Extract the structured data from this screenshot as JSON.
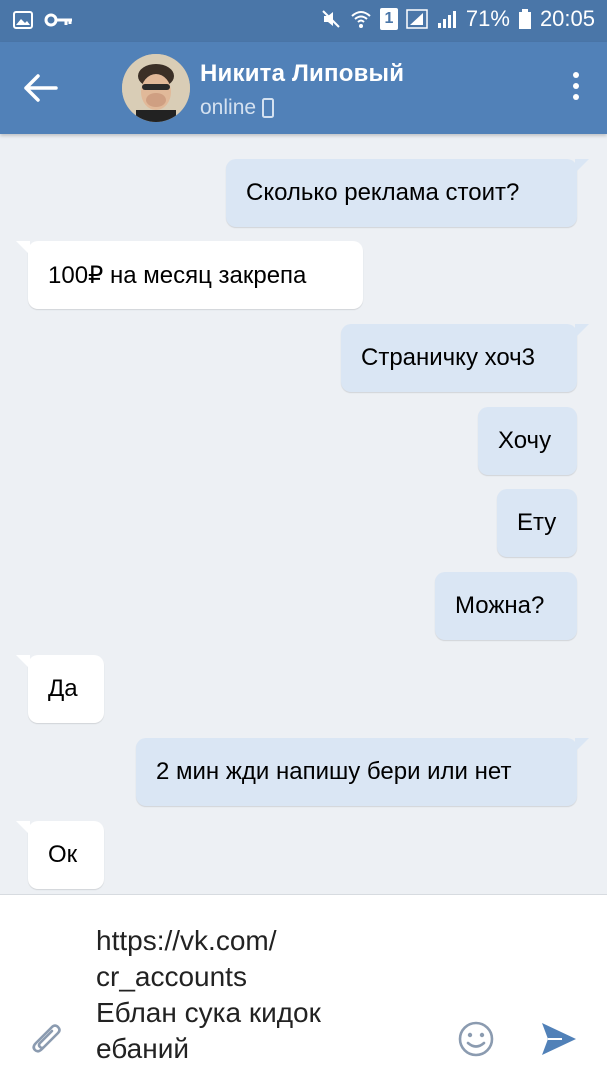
{
  "status_bar": {
    "battery": "71%",
    "time": "20:05",
    "sim_label": "1",
    "icons": [
      "image-icon",
      "key-icon",
      "mute-icon",
      "wifi-icon",
      "sim-icon",
      "signal-icon",
      "battery-icon"
    ]
  },
  "header": {
    "contact_name": "Никита Липовый",
    "status": "online",
    "icons": [
      "back-arrow-icon",
      "avatar",
      "phone-icon",
      "more-vert-icon"
    ]
  },
  "messages": [
    {
      "direction": "out",
      "text": "Сколько реклама стоит?"
    },
    {
      "direction": "in",
      "text": "100₽ на месяц закрепа"
    },
    {
      "direction": "out",
      "text": "Страничку хоч3"
    },
    {
      "direction": "out",
      "text": "Хочу"
    },
    {
      "direction": "out",
      "text": "Ету"
    },
    {
      "direction": "out",
      "text": "Можна?"
    },
    {
      "direction": "in",
      "text": "Да"
    },
    {
      "direction": "out",
      "text": "2 мин жди напишу бери или нет"
    },
    {
      "direction": "in",
      "text": "Ок"
    }
  ],
  "composer": {
    "text": "https://vk.com/\ncr_accounts\nЕблан сука кидок\nебаний",
    "icons": [
      "paperclip-icon",
      "emoji-icon",
      "send-icon"
    ]
  },
  "colors": {
    "status_bar": "#4a76a8",
    "header": "#5181b8",
    "background": "#edf0f4",
    "bubble_in": "#ffffff",
    "bubble_out": "#dae6f4",
    "accent": "#5181b8"
  }
}
